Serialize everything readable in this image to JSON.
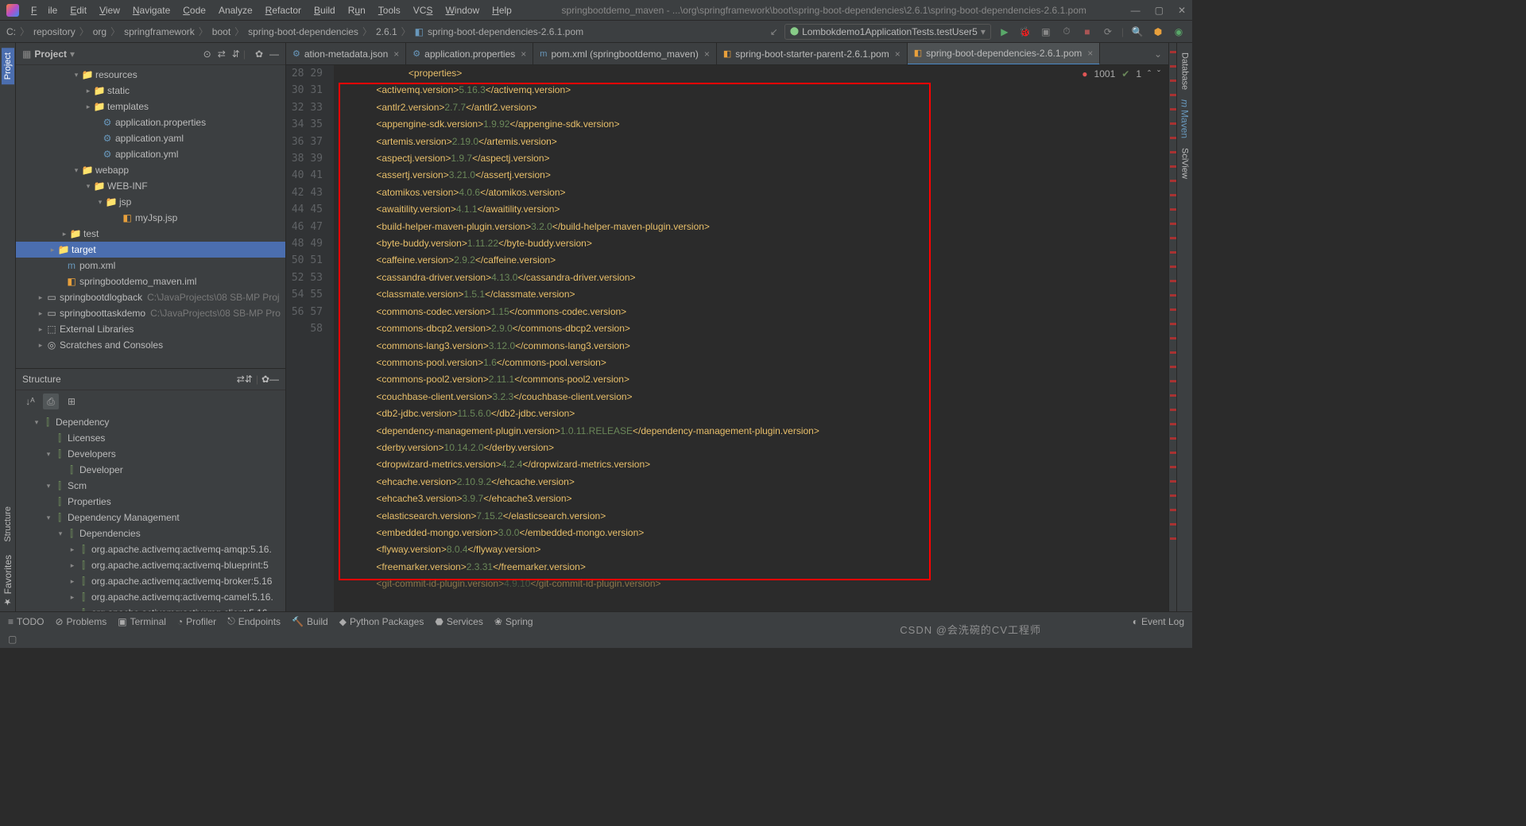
{
  "menu": {
    "file": "File",
    "edit": "Edit",
    "view": "View",
    "navigate": "Navigate",
    "code": "Code",
    "analyze": "Analyze",
    "refactor": "Refactor",
    "build": "Build",
    "run": "Run",
    "tools": "Tools",
    "vcs": "VCS",
    "window": "Window",
    "help": "Help"
  },
  "window_title": "springbootdemo_maven - ...\\org\\springframework\\boot\\spring-boot-dependencies\\2.6.1\\spring-boot-dependencies-2.6.1.pom",
  "breadcrumbs": [
    "C:",
    "repository",
    "org",
    "springframework",
    "boot",
    "spring-boot-dependencies",
    "2.6.1",
    "spring-boot-dependencies-2.6.1.pom"
  ],
  "run_config": "Lombokdemo1ApplicationTests.testUser5",
  "left_tabs": {
    "project": "Project",
    "structure": "Structure",
    "favorites": "Favorites"
  },
  "right_tabs": {
    "database": "Database",
    "maven": "Maven",
    "sciview": "SciView"
  },
  "project_panel": {
    "title": "Project"
  },
  "tree": [
    {
      "ind": 70,
      "arr": "▾",
      "icon": "📁",
      "cls": "dir",
      "label": "resources"
    },
    {
      "ind": 85,
      "arr": "▸",
      "icon": "📁",
      "cls": "sdir",
      "label": "static"
    },
    {
      "ind": 85,
      "arr": "▸",
      "icon": "📁",
      "cls": "sdir",
      "label": "templates"
    },
    {
      "ind": 95,
      "arr": "",
      "icon": "⚙",
      "cls": "fprp",
      "label": "application.properties"
    },
    {
      "ind": 95,
      "arr": "",
      "icon": "⚙",
      "cls": "fprp",
      "label": "application.yaml"
    },
    {
      "ind": 95,
      "arr": "",
      "icon": "⚙",
      "cls": "fprp",
      "label": "application.yml"
    },
    {
      "ind": 70,
      "arr": "▾",
      "icon": "📁",
      "cls": "dir",
      "label": "webapp"
    },
    {
      "ind": 85,
      "arr": "▾",
      "icon": "📁",
      "cls": "sdir",
      "label": "WEB-INF"
    },
    {
      "ind": 100,
      "arr": "▾",
      "icon": "📁",
      "cls": "sdir",
      "label": "jsp"
    },
    {
      "ind": 120,
      "arr": "",
      "icon": "◧",
      "cls": "fxml",
      "label": "myJsp.jsp"
    },
    {
      "ind": 55,
      "arr": "▸",
      "icon": "📁",
      "cls": "sdir",
      "label": "test"
    },
    {
      "ind": 40,
      "arr": "▸",
      "icon": "📁",
      "cls": "fxml",
      "label": "target",
      "sel": true
    },
    {
      "ind": 50,
      "arr": "",
      "icon": "m",
      "cls": "fprp",
      "label": "pom.xml"
    },
    {
      "ind": 50,
      "arr": "",
      "icon": "◧",
      "cls": "fxml",
      "label": "springbootdemo_maven.iml"
    },
    {
      "ind": 25,
      "arr": "▸",
      "icon": "▭",
      "cls": "",
      "label": "springbootdlogback",
      "hint": "C:\\JavaProjects\\08 SB-MP Proj"
    },
    {
      "ind": 25,
      "arr": "▸",
      "icon": "▭",
      "cls": "",
      "label": "springboottaskdemo",
      "hint": "C:\\JavaProjects\\08 SB-MP Pro"
    },
    {
      "ind": 25,
      "arr": "▸",
      "icon": "⬚",
      "cls": "",
      "label": "External Libraries"
    },
    {
      "ind": 25,
      "arr": "▸",
      "icon": "◎",
      "cls": "",
      "label": "Scratches and Consoles"
    }
  ],
  "structure_panel": {
    "title": "Structure"
  },
  "structure": [
    {
      "ind": 20,
      "arr": "▾",
      "label": "Dependency"
    },
    {
      "ind": 35,
      "arr": "",
      "label": "Licenses"
    },
    {
      "ind": 35,
      "arr": "▾",
      "label": "Developers"
    },
    {
      "ind": 50,
      "arr": "",
      "label": "Developer"
    },
    {
      "ind": 35,
      "arr": "▾",
      "label": "Scm"
    },
    {
      "ind": 35,
      "arr": "",
      "label": "Properties"
    },
    {
      "ind": 35,
      "arr": "▾",
      "label": "Dependency Management"
    },
    {
      "ind": 50,
      "arr": "▾",
      "label": "Dependencies"
    },
    {
      "ind": 65,
      "arr": "▸",
      "label": "org.apache.activemq:activemq-amqp:5.16."
    },
    {
      "ind": 65,
      "arr": "▸",
      "label": "org.apache.activemq:activemq-blueprint:5"
    },
    {
      "ind": 65,
      "arr": "▸",
      "label": "org.apache.activemq:activemq-broker:5.16"
    },
    {
      "ind": 65,
      "arr": "▸",
      "label": "org.apache.activemq:activemq-camel:5.16."
    },
    {
      "ind": 65,
      "arr": "▸",
      "label": "org.apache.activemq:activemq-client:5.16"
    }
  ],
  "tabs": [
    {
      "icon": "⚙",
      "cls": "fprp",
      "label": "ation-metadata.json"
    },
    {
      "icon": "⚙",
      "cls": "fprp",
      "label": "application.properties"
    },
    {
      "icon": "m",
      "cls": "fprp",
      "label": "pom.xml (springbootdemo_maven)"
    },
    {
      "icon": "◧",
      "cls": "fxml",
      "label": "spring-boot-starter-parent-2.6.1.pom"
    },
    {
      "icon": "◧",
      "cls": "fxml",
      "label": "spring-boot-dependencies-2.6.1.pom",
      "act": true
    }
  ],
  "inspect": {
    "errors": "1001",
    "warn": "1"
  },
  "code_start": 28,
  "code": [
    {
      "ind": 3,
      "tag": "properties",
      "val": null,
      "close": null
    },
    {
      "ind": 4,
      "tag": "activemq.version",
      "val": "5.16.3",
      "close": "activemq.version"
    },
    {
      "ind": 4,
      "tag": "antlr2.version",
      "val": "2.7.7",
      "close": "antlr2.version"
    },
    {
      "ind": 4,
      "tag": "appengine-sdk.version",
      "val": "1.9.92",
      "close": "appengine-sdk.version"
    },
    {
      "ind": 4,
      "tag": "artemis.version",
      "val": "2.19.0",
      "close": "artemis.version"
    },
    {
      "ind": 4,
      "tag": "aspectj.version",
      "val": "1.9.7",
      "close": "aspectj.version"
    },
    {
      "ind": 4,
      "tag": "assertj.version",
      "val": "3.21.0",
      "close": "assertj.version"
    },
    {
      "ind": 4,
      "tag": "atomikos.version",
      "val": "4.0.6",
      "close": "atomikos.version"
    },
    {
      "ind": 4,
      "tag": "awaitility.version",
      "val": "4.1.1",
      "close": "awaitility.version"
    },
    {
      "ind": 4,
      "tag": "build-helper-maven-plugin.version",
      "val": "3.2.0",
      "close": "build-helper-maven-plugin.version"
    },
    {
      "ind": 4,
      "tag": "byte-buddy.version",
      "val": "1.11.22",
      "close": "byte-buddy.version"
    },
    {
      "ind": 4,
      "tag": "caffeine.version",
      "val": "2.9.2",
      "close": "caffeine.version"
    },
    {
      "ind": 4,
      "tag": "cassandra-driver.version",
      "val": "4.13.0",
      "close": "cassandra-driver.version"
    },
    {
      "ind": 4,
      "tag": "classmate.version",
      "val": "1.5.1",
      "close": "classmate.version"
    },
    {
      "ind": 4,
      "tag": "commons-codec.version",
      "val": "1.15",
      "close": "commons-codec.version"
    },
    {
      "ind": 4,
      "tag": "commons-dbcp2.version",
      "val": "2.9.0",
      "close": "commons-dbcp2.version"
    },
    {
      "ind": 4,
      "tag": "commons-lang3.version",
      "val": "3.12.0",
      "close": "commons-lang3.version"
    },
    {
      "ind": 4,
      "tag": "commons-pool.version",
      "val": "1.6",
      "close": "commons-pool.version"
    },
    {
      "ind": 4,
      "tag": "commons-pool2.version",
      "val": "2.11.1",
      "close": "commons-pool2.version"
    },
    {
      "ind": 4,
      "tag": "couchbase-client.version",
      "val": "3.2.3",
      "close": "couchbase-client.version"
    },
    {
      "ind": 4,
      "tag": "db2-jdbc.version",
      "val": "11.5.6.0",
      "close": "db2-jdbc.version"
    },
    {
      "ind": 4,
      "tag": "dependency-management-plugin.version",
      "val": "1.0.11.RELEASE",
      "close": "dependency-management-plugin.version"
    },
    {
      "ind": 4,
      "tag": "derby.version",
      "val": "10.14.2.0",
      "close": "derby.version"
    },
    {
      "ind": 4,
      "tag": "dropwizard-metrics.version",
      "val": "4.2.4",
      "close": "dropwizard-metrics.version"
    },
    {
      "ind": 4,
      "tag": "ehcache.version",
      "val": "2.10.9.2",
      "close": "ehcache.version"
    },
    {
      "ind": 4,
      "tag": "ehcache3.version",
      "val": "3.9.7",
      "close": "ehcache3.version"
    },
    {
      "ind": 4,
      "tag": "elasticsearch.version",
      "val": "7.15.2",
      "close": "elasticsearch.version"
    },
    {
      "ind": 4,
      "tag": "embedded-mongo.version",
      "val": "3.0.0",
      "close": "embedded-mongo.version"
    },
    {
      "ind": 4,
      "tag": "flyway.version",
      "val": "8.0.4",
      "close": "flyway.version"
    },
    {
      "ind": 4,
      "tag": "freemarker.version",
      "val": "2.3.31",
      "close": "freemarker.version"
    },
    {
      "ind": 4,
      "tag": "git-commit-id-plugin.version",
      "val": "4.9.10",
      "close": "git-commit-id-plugin.version",
      "dim": true
    }
  ],
  "bottom": {
    "todo": "TODO",
    "problems": "Problems",
    "terminal": "Terminal",
    "profiler": "Profiler",
    "endpoints": "Endpoints",
    "build": "Build",
    "python": "Python Packages",
    "services": "Services",
    "spring": "Spring",
    "eventlog": "Event Log"
  },
  "watermark": "CSDN @会洗碗的CV工程师"
}
